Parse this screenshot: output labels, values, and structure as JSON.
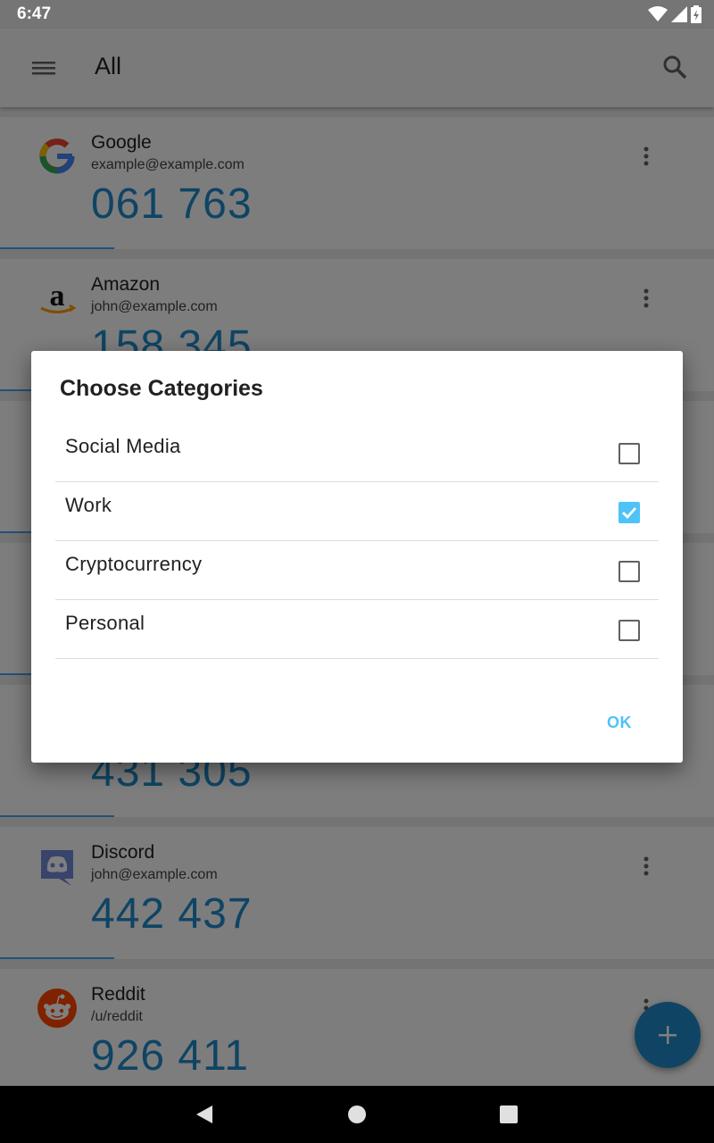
{
  "status_bar": {
    "time": "6:47"
  },
  "app_bar": {
    "title": "All"
  },
  "accounts": [
    {
      "issuer": "Google",
      "account": "example@example.com",
      "code": "061 763",
      "icon": "google-icon"
    },
    {
      "issuer": "Amazon",
      "account": "john@example.com",
      "code": "158 345",
      "icon": "amazon-icon"
    },
    {
      "issuer": "",
      "account": "",
      "code": "431 305",
      "icon": ""
    },
    {
      "issuer": "Discord",
      "account": "john@example.com",
      "code": "442 437",
      "icon": "discord-icon"
    },
    {
      "issuer": "Reddit",
      "account": "/u/reddit",
      "code": "926 411",
      "icon": "reddit-icon"
    }
  ],
  "dialog": {
    "title": "Choose Categories",
    "options": [
      {
        "label": "Social Media",
        "checked": false
      },
      {
        "label": "Work",
        "checked": true
      },
      {
        "label": "Cryptocurrency",
        "checked": false
      },
      {
        "label": "Personal",
        "checked": false
      }
    ],
    "ok_label": "OK"
  },
  "colors": {
    "accent": "#4fc3f7",
    "code": "#1e88c8",
    "fab": "#1e88c8"
  }
}
